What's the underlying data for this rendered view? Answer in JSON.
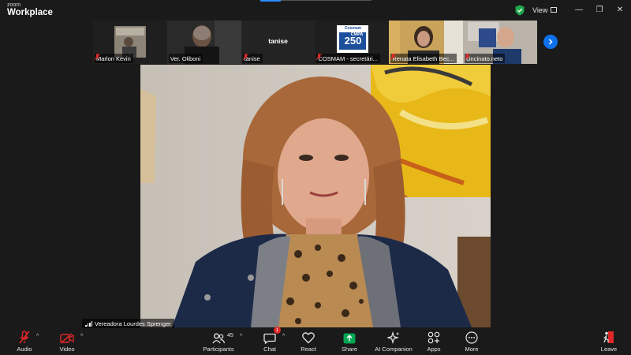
{
  "app": {
    "brand_small": "zoom",
    "brand_big": "Workplace",
    "view_label": "View"
  },
  "window_controls": {
    "minimize": "—",
    "restore": "❐",
    "close": "✕"
  },
  "participants_strip": [
    {
      "name": "Marlon Kevin",
      "muted": true
    },
    {
      "name": "Ver. Oliboni",
      "muted": false
    },
    {
      "name": "tanise",
      "muted": true,
      "display_name": "tanise"
    },
    {
      "name": "COSMAM - secretári...",
      "muted": true,
      "logo_top": "Cosmam",
      "logo_main": "250",
      "logo_sub": "CMPA"
    },
    {
      "name": "Renata Elisabeth Bec...",
      "muted": true
    },
    {
      "name": "cincinato.neto",
      "muted": true
    }
  ],
  "active_speaker": {
    "name": "Vereadora Lourdes Sprenger"
  },
  "toolbar": {
    "audio": "Audio",
    "video": "Video",
    "participants": "Participants",
    "participants_count": "45",
    "chat": "Chat",
    "chat_badge": "1",
    "react": "React",
    "share": "Share",
    "ai_companion": "AI Companion",
    "apps": "Apps",
    "more": "More",
    "leave": "Leave"
  },
  "colors": {
    "background": "#1a1a1a",
    "accent": "#0e72ed",
    "share_green": "#00a651",
    "mute_red": "#e02828",
    "shield_green": "#1fa84a"
  }
}
